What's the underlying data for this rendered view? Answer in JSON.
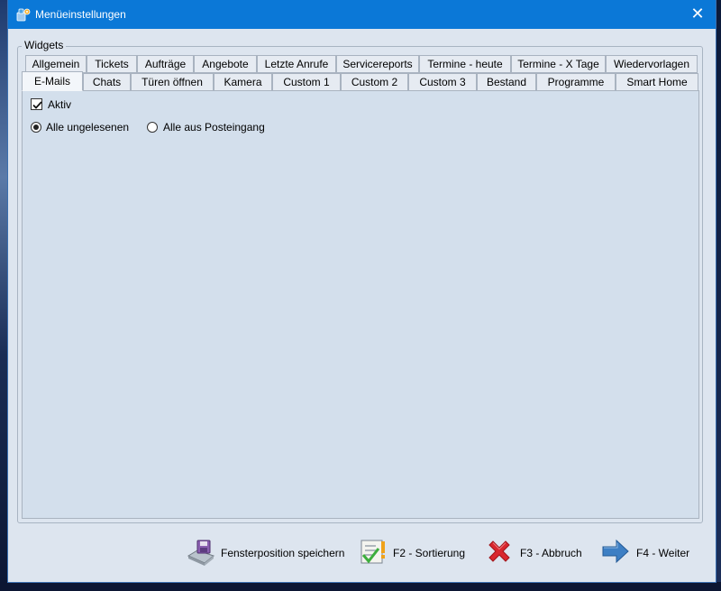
{
  "window": {
    "title": "Menüeinstellungen",
    "close_glyph": "✕"
  },
  "group": {
    "legend": "Widgets"
  },
  "tabs_row1": [
    "Allgemein",
    "Tickets",
    "Aufträge",
    "Angebote",
    "Letzte Anrufe",
    "Servicereports",
    "Termine - heute",
    "Termine - X Tage",
    "Wiedervorlagen"
  ],
  "tabs_row2": [
    "E-Mails",
    "Chats",
    "Türen öffnen",
    "Kamera",
    "Custom 1",
    "Custom 2",
    "Custom 3",
    "Bestand",
    "Programme",
    "Smart Home"
  ],
  "active_tab": "E-Mails",
  "panel": {
    "aktiv_label": "Aktiv",
    "aktiv_checked": true,
    "radio_unread_label": "Alle ungelesenen",
    "radio_inbox_label": "Alle aus Posteingang",
    "selected_radio": "Alle ungelesenen"
  },
  "actions": {
    "save_position": "Fensterposition speichern",
    "sort": "F2 - Sortierung",
    "cancel": "F3 - Abbruch",
    "next": "F4 - Weiter"
  },
  "icons": {
    "app": "app-settings-icon",
    "save": "floppy-save-icon",
    "sort": "checklist-icon",
    "cancel": "red-x-icon",
    "next": "blue-arrow-right-icon"
  },
  "colors": {
    "titlebar": "#0b78d7",
    "window_bg": "#dde5ef",
    "panel_bg": "#d3dfec",
    "cancel_red": "#d9272e",
    "next_blue": "#3d7fc4"
  }
}
